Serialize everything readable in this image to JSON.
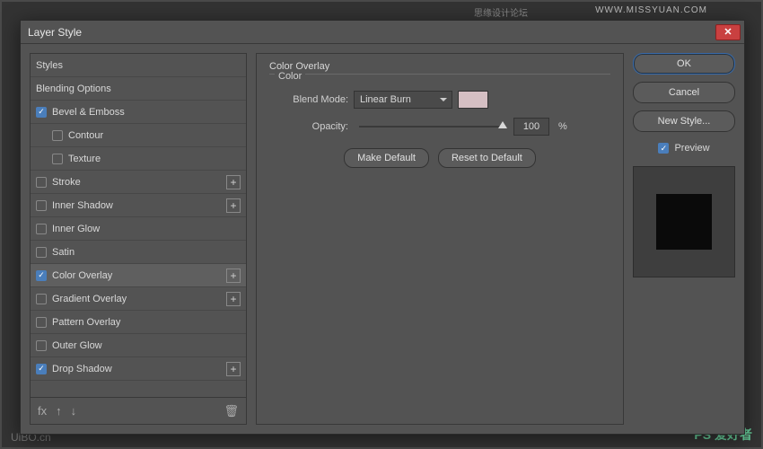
{
  "watermarks": {
    "top_right": "WWW.MISSYUAN.COM",
    "top_center": "思缘设计论坛",
    "bottom_right": "PS 爱好者",
    "bottom_left": "UiBO.cn"
  },
  "dialog": {
    "title": "Layer Style"
  },
  "effects": {
    "styles": "Styles",
    "blending_options": "Blending Options",
    "bevel_emboss": "Bevel & Emboss",
    "contour": "Contour",
    "texture": "Texture",
    "stroke": "Stroke",
    "inner_shadow": "Inner Shadow",
    "inner_glow": "Inner Glow",
    "satin": "Satin",
    "color_overlay": "Color Overlay",
    "gradient_overlay": "Gradient Overlay",
    "pattern_overlay": "Pattern Overlay",
    "outer_glow": "Outer Glow",
    "drop_shadow": "Drop Shadow"
  },
  "center": {
    "section_title": "Color Overlay",
    "group_label": "Color",
    "blend_mode_label": "Blend Mode:",
    "blend_mode_value": "Linear Burn",
    "opacity_label": "Opacity:",
    "opacity_value": "100",
    "opacity_unit": "%",
    "color_swatch": "#d5bfc3",
    "make_default": "Make Default",
    "reset_default": "Reset to Default"
  },
  "actions": {
    "ok": "OK",
    "cancel": "Cancel",
    "new_style": "New Style...",
    "preview": "Preview"
  },
  "footer": {
    "fx": "fx",
    "plus": "+"
  }
}
